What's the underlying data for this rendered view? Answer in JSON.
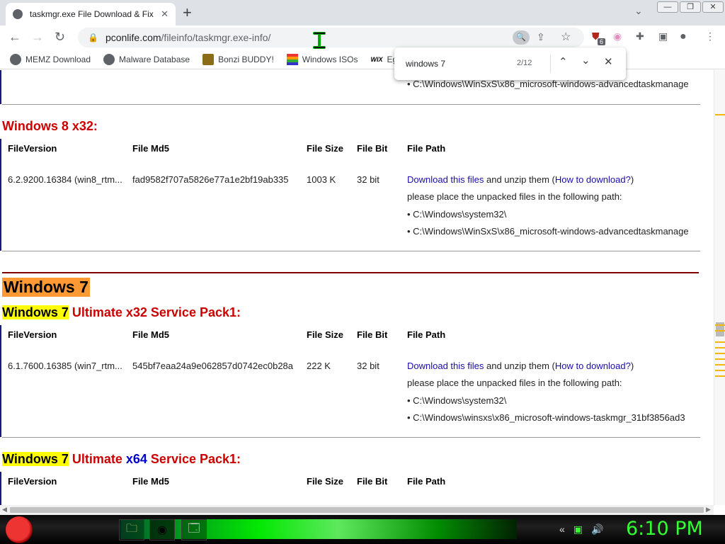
{
  "browser": {
    "tab_title": "taskmgr.exe File Download & Fix",
    "tab_close": "✕",
    "new_tab": "+",
    "url_host": "pconlife.com",
    "url_path": "/fileinfo/taskmgr.exe-info/",
    "window_controls": [
      "—",
      "❐",
      "✕"
    ],
    "extension_badge": "6"
  },
  "bookmarks": [
    {
      "label": "MEMZ Download",
      "icon": "globe-icon"
    },
    {
      "label": "Malware Database",
      "icon": "globe-icon"
    },
    {
      "label": "Bonzi BUDDY!",
      "icon": "bonzi-icon"
    },
    {
      "label": "Windows ISOs",
      "icon": "windows-flag-icon"
    },
    {
      "label": "Egy",
      "icon": "wix-icon",
      "glyph": "WIX"
    }
  ],
  "find_bar": {
    "query": "windows 7",
    "count": "2/12"
  },
  "page": {
    "top_partial_path": "• C:\\Windows\\WinSxS\\x86_microsoft-windows-advancedtaskmanage",
    "columns": [
      "FileVersion",
      "File Md5",
      "File Size",
      "File Bit",
      "File Path"
    ],
    "win8": {
      "heading": "Windows 8 x32:",
      "version": "6.2.9200.16384 (win8_rtm...",
      "md5": "fad9582f707a5826e77a1e2bf19ab335",
      "size": "1003 K",
      "bit": "32 bit",
      "download_link": "Download this files",
      "unzip_text": " and unzip them (",
      "howto_link": "How to download?",
      "close_paren": ")",
      "place_text": "please place the unpacked files in the following path:",
      "path1": "• C:\\Windows\\system32\\",
      "path2": "• C:\\Windows\\WinSxS\\x86_microsoft-windows-advancedtaskmanage"
    },
    "win7_heading": "Windows 7",
    "win7_x32": {
      "heading_hl": "Windows 7",
      "heading_rest": " Ultimate x32 Service Pack1:",
      "version": "6.1.7600.16385 (win7_rtm...",
      "md5": "545bf7eaa24a9e062857d0742ec0b28a",
      "size": "222 K",
      "bit": "32 bit",
      "download_link": "Download this files",
      "unzip_text": " and unzip them (",
      "howto_link": "How to download?",
      "close_paren": ")",
      "place_text": "please place the unpacked files in the following path:",
      "path1": "• C:\\Windows\\system32\\",
      "path2": "• C:\\Windows\\winsxs\\x86_microsoft-windows-taskmgr_31bf3856ad3"
    },
    "win7_x64": {
      "heading_hl": "Windows 7",
      "heading_mid": " Ultimate ",
      "heading_blue": "x64",
      "heading_rest": " Service Pack1:"
    }
  },
  "taskbar": {
    "clock": "6:10 PM"
  }
}
